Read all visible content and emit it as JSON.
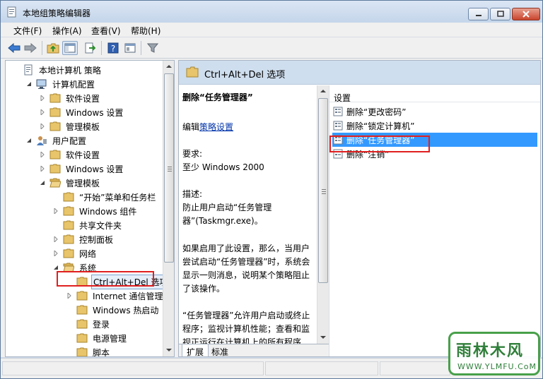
{
  "window": {
    "title": "本地组策略编辑器"
  },
  "menu": [
    "文件(F)",
    "操作(A)",
    "查看(V)",
    "帮助(H)"
  ],
  "tree": {
    "rows": [
      {
        "label": "本地计算机 策略",
        "icon": "policy-doc-icon",
        "expander": "none"
      },
      {
        "label": "计算机配置",
        "icon": "computer-icon",
        "expander": "expanded"
      },
      {
        "label": "软件设置",
        "icon": "folder-icon",
        "expander": "collapsed"
      },
      {
        "label": "Windows 设置",
        "icon": "folder-icon",
        "expander": "collapsed"
      },
      {
        "label": "管理模板",
        "icon": "folder-icon",
        "expander": "collapsed"
      },
      {
        "label": "用户配置",
        "icon": "user-icon",
        "expander": "expanded"
      },
      {
        "label": "软件设置",
        "icon": "folder-icon",
        "expander": "collapsed"
      },
      {
        "label": "Windows 设置",
        "icon": "folder-icon",
        "expander": "collapsed"
      },
      {
        "label": "管理模板",
        "icon": "folder-open-icon",
        "expander": "expanded"
      },
      {
        "label": "“开始”菜单和任务栏",
        "icon": "folder-icon",
        "expander": "none"
      },
      {
        "label": "Windows 组件",
        "icon": "folder-icon",
        "expander": "collapsed"
      },
      {
        "label": "共享文件夹",
        "icon": "folder-icon",
        "expander": "none"
      },
      {
        "label": "控制面板",
        "icon": "folder-icon",
        "expander": "collapsed"
      },
      {
        "label": "网络",
        "icon": "folder-icon",
        "expander": "collapsed"
      },
      {
        "label": "系统",
        "icon": "folder-open-icon",
        "expander": "expanded"
      },
      {
        "label": "Ctrl+Alt+Del 选项",
        "icon": "folder-icon",
        "expander": "none",
        "selected": true
      },
      {
        "label": "Internet 通信管理",
        "icon": "folder-icon",
        "expander": "collapsed"
      },
      {
        "label": "Windows 热启动",
        "icon": "folder-icon",
        "expander": "none"
      },
      {
        "label": "登录",
        "icon": "folder-icon",
        "expander": "none"
      },
      {
        "label": "电源管理",
        "icon": "folder-icon",
        "expander": "none"
      },
      {
        "label": "脚本",
        "icon": "folder-icon",
        "expander": "none"
      }
    ]
  },
  "right": {
    "header": "Ctrl+Alt+Del 选项",
    "desc": {
      "title": "删除“任务管理器”",
      "edit_prefix": "编辑",
      "edit_link": "策略设置",
      "req_label": "要求:",
      "req_value": "至少 Windows 2000",
      "desc_label": "描述:",
      "desc_value": "防止用户启动“任务管理器”(Taskmgr.exe)。",
      "para1": "如果启用了此设置，那么，当用户尝试启动“任务管理器”时，系统会显示一则消息，说明某个策略阻止了该操作。",
      "para2": "“任务管理器”允许用户启动或终止程序；监视计算机性能；查看和监视正运行在计算机上的所有程序"
    },
    "settings_header": "设置",
    "settings": [
      {
        "label": "删除“更改密码”"
      },
      {
        "label": "删除“锁定计算机”"
      },
      {
        "label": "删除“任务管理器”",
        "selected": true
      },
      {
        "label": "删除“注销”"
      }
    ],
    "tabs": [
      "扩展",
      "标准"
    ]
  },
  "watermark": {
    "main": "雨林木风",
    "sub": "WWW.YLMFU.CoM"
  },
  "colors": {
    "selection": "#3399ff",
    "highlight_box": "#e02020",
    "folder": "#e8c46a"
  }
}
